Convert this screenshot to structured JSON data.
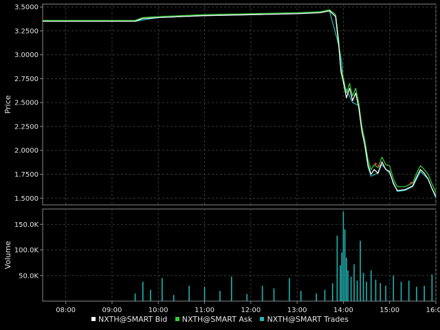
{
  "colors": {
    "background": "#000000",
    "panel_border": "#8c8c8c",
    "grid": "#3a3a3a",
    "text": "#e6e6e6",
    "bid": "#ffffff",
    "ask": "#33cc33",
    "trades": "#1fb5b5",
    "marker": "#ff3333"
  },
  "legend": [
    {
      "label": "NXTH@SMART Bid",
      "color": "#ffffff"
    },
    {
      "label": "NXTH@SMART Ask",
      "color": "#33cc33"
    },
    {
      "label": "NXTH@SMART Trades",
      "color": "#1fb5b5"
    }
  ],
  "chart_data": [
    {
      "type": "line",
      "ylabel": "Price",
      "ylim": [
        1.43,
        3.53
      ],
      "yticks": [
        "1.5000",
        "1.7500",
        "2.0000",
        "2.2500",
        "2.5000",
        "2.7500",
        "3.0000",
        "3.2500",
        "3.5000"
      ],
      "x_range": [
        "07:30",
        "16:00"
      ],
      "grid": true,
      "series": [
        {
          "name": "NXTH@SMART Bid",
          "color": "#ffffff",
          "points": [
            [
              "07:30",
              3.35
            ],
            [
              "09:30",
              3.35
            ],
            [
              "09:40",
              3.38
            ],
            [
              "10:00",
              3.39
            ],
            [
              "10:30",
              3.4
            ],
            [
              "11:00",
              3.41
            ],
            [
              "12:00",
              3.42
            ],
            [
              "13:00",
              3.43
            ],
            [
              "13:30",
              3.44
            ],
            [
              "13:42",
              3.46
            ],
            [
              "13:50",
              3.4
            ],
            [
              "13:54",
              3.1
            ],
            [
              "13:57",
              2.82
            ],
            [
              "14:00",
              2.72
            ],
            [
              "14:04",
              2.55
            ],
            [
              "14:08",
              2.65
            ],
            [
              "14:12",
              2.52
            ],
            [
              "14:16",
              2.6
            ],
            [
              "14:20",
              2.45
            ],
            [
              "14:24",
              2.2
            ],
            [
              "14:28",
              2.05
            ],
            [
              "14:32",
              1.85
            ],
            [
              "14:36",
              1.75
            ],
            [
              "14:40",
              1.8
            ],
            [
              "14:45",
              1.76
            ],
            [
              "14:50",
              1.88
            ],
            [
              "14:55",
              1.8
            ],
            [
              "15:00",
              1.78
            ],
            [
              "15:05",
              1.65
            ],
            [
              "15:10",
              1.58
            ],
            [
              "15:20",
              1.59
            ],
            [
              "15:30",
              1.63
            ],
            [
              "15:35",
              1.72
            ],
            [
              "15:40",
              1.8
            ],
            [
              "15:45",
              1.76
            ],
            [
              "15:50",
              1.7
            ],
            [
              "15:55",
              1.6
            ],
            [
              "16:00",
              1.52
            ]
          ]
        },
        {
          "name": "NXTH@SMART Ask",
          "color": "#33cc33",
          "points": [
            [
              "07:30",
              3.36
            ],
            [
              "09:30",
              3.36
            ],
            [
              "09:40",
              3.39
            ],
            [
              "10:00",
              3.4
            ],
            [
              "10:30",
              3.41
            ],
            [
              "11:00",
              3.42
            ],
            [
              "12:00",
              3.43
            ],
            [
              "13:00",
              3.44
            ],
            [
              "13:30",
              3.45
            ],
            [
              "13:42",
              3.47
            ],
            [
              "13:50",
              3.42
            ],
            [
              "13:54",
              3.15
            ],
            [
              "13:57",
              2.86
            ],
            [
              "14:00",
              2.76
            ],
            [
              "14:04",
              2.6
            ],
            [
              "14:08",
              2.7
            ],
            [
              "14:12",
              2.57
            ],
            [
              "14:16",
              2.65
            ],
            [
              "14:20",
              2.5
            ],
            [
              "14:24",
              2.25
            ],
            [
              "14:28",
              2.1
            ],
            [
              "14:32",
              1.9
            ],
            [
              "14:36",
              1.8
            ],
            [
              "14:40",
              1.85
            ],
            [
              "14:45",
              1.82
            ],
            [
              "14:50",
              1.93
            ],
            [
              "14:55",
              1.85
            ],
            [
              "15:00",
              1.84
            ],
            [
              "15:05",
              1.7
            ],
            [
              "15:10",
              1.62
            ],
            [
              "15:20",
              1.62
            ],
            [
              "15:30",
              1.66
            ],
            [
              "15:35",
              1.76
            ],
            [
              "15:40",
              1.84
            ],
            [
              "15:45",
              1.8
            ],
            [
              "15:50",
              1.75
            ],
            [
              "15:55",
              1.65
            ],
            [
              "16:00",
              1.56
            ]
          ]
        },
        {
          "name": "NXTH@SMART Trades",
          "color": "#1fb5b5",
          "points": [
            [
              "09:30",
              3.35
            ],
            [
              "10:00",
              3.39
            ],
            [
              "11:00",
              3.41
            ],
            [
              "12:00",
              3.42
            ],
            [
              "13:00",
              3.43
            ],
            [
              "13:42",
              3.46
            ],
            [
              "13:54",
              3.1
            ],
            [
              "13:58",
              2.92
            ],
            [
              "14:00",
              2.7
            ],
            [
              "14:06",
              2.6
            ],
            [
              "14:12",
              2.5
            ],
            [
              "14:20",
              2.47
            ],
            [
              "14:26",
              2.15
            ],
            [
              "14:32",
              1.82
            ],
            [
              "14:36",
              1.73
            ],
            [
              "14:44",
              1.76
            ],
            [
              "14:50",
              1.85
            ],
            [
              "15:00",
              1.76
            ],
            [
              "15:10",
              1.57
            ],
            [
              "15:20",
              1.58
            ],
            [
              "15:30",
              1.62
            ],
            [
              "15:40",
              1.78
            ],
            [
              "15:50",
              1.7
            ],
            [
              "16:00",
              1.5
            ]
          ]
        }
      ],
      "markers": [
        [
          "14:42",
          1.86
        ],
        [
          "14:46",
          1.84
        ],
        [
          "15:28",
          1.66
        ]
      ]
    },
    {
      "type": "bar",
      "ylabel": "Volume",
      "ylim": [
        0,
        180000
      ],
      "yticks": [
        "50.0K",
        "100.0K",
        "150.0K"
      ],
      "x_range": [
        "07:30",
        "16:00"
      ],
      "xticks": [
        "08:00",
        "09:00",
        "10:00",
        "11:00",
        "12:00",
        "13:00",
        "14:00",
        "15:00",
        "16:00"
      ],
      "grid": true,
      "series": [
        {
          "name": "NXTH@SMART Trades",
          "color": "#1fb5b5",
          "points": [
            [
              "09:30",
              15000
            ],
            [
              "09:40",
              38000
            ],
            [
              "09:50",
              22000
            ],
            [
              "10:05",
              45000
            ],
            [
              "10:20",
              12000
            ],
            [
              "10:40",
              30000
            ],
            [
              "11:00",
              28000
            ],
            [
              "11:20",
              20000
            ],
            [
              "11:35",
              48000
            ],
            [
              "11:55",
              14000
            ],
            [
              "12:15",
              30000
            ],
            [
              "12:30",
              25000
            ],
            [
              "12:50",
              45000
            ],
            [
              "13:05",
              20000
            ],
            [
              "13:25",
              15000
            ],
            [
              "13:36",
              22000
            ],
            [
              "13:46",
              35000
            ],
            [
              "13:52",
              128000
            ],
            [
              "13:56",
              70000
            ],
            [
              "13:58",
              95000
            ],
            [
              "14:00",
              175000
            ],
            [
              "14:02",
              140000
            ],
            [
              "14:04",
              85000
            ],
            [
              "14:06",
              60000
            ],
            [
              "14:10",
              48000
            ],
            [
              "14:14",
              72000
            ],
            [
              "14:18",
              40000
            ],
            [
              "14:22",
              118000
            ],
            [
              "14:26",
              55000
            ],
            [
              "14:30",
              38000
            ],
            [
              "14:36",
              60000
            ],
            [
              "14:42",
              42000
            ],
            [
              "14:48",
              35000
            ],
            [
              "14:55",
              30000
            ],
            [
              "15:05",
              50000
            ],
            [
              "15:15",
              38000
            ],
            [
              "15:25",
              40000
            ],
            [
              "15:35",
              28000
            ],
            [
              "15:45",
              30000
            ],
            [
              "15:55",
              52000
            ]
          ]
        }
      ]
    }
  ]
}
